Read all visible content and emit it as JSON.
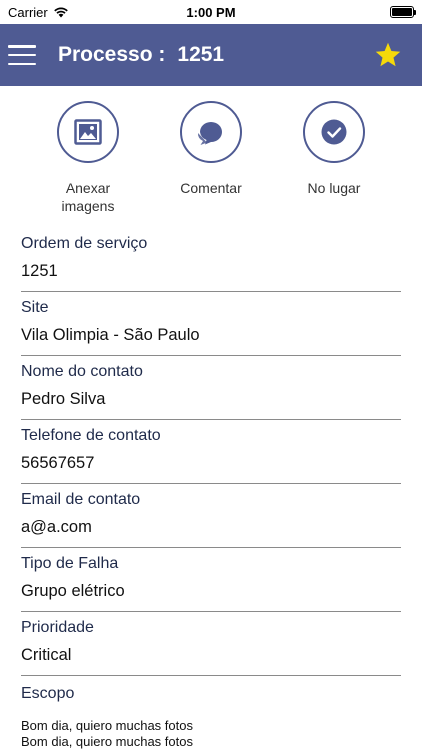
{
  "status_bar": {
    "carrier": "Carrier",
    "time": "1:00 PM"
  },
  "nav": {
    "title_prefix": "Processo :",
    "process_number": "1251"
  },
  "actions": [
    {
      "label": "Anexar imagens"
    },
    {
      "label": "Comentar"
    },
    {
      "label": "No lugar"
    }
  ],
  "fields": [
    {
      "label": "Ordem de serviço",
      "value": "1251"
    },
    {
      "label": "Site",
      "value": "Vila Olimpia - São Paulo"
    },
    {
      "label": "Nome do contato",
      "value": "Pedro Silva"
    },
    {
      "label": "Telefone de contato",
      "value": "56567657"
    },
    {
      "label": "Email de contato",
      "value": "a@a.com"
    },
    {
      "label": "Tipo de Falha",
      "value": "Grupo elétrico"
    },
    {
      "label": "Prioridade",
      "value": "Critical"
    }
  ],
  "escopo": {
    "label": "Escopo",
    "text": "Bom dia, quiero muchas fotos\nBom dia, quiero muchas fotos"
  },
  "colors": {
    "nav_bg": "#4f5b93",
    "accent": "#4f5b93",
    "star": "#f5d90a"
  },
  "icons": [
    "wifi-icon",
    "battery-icon",
    "menu-icon",
    "star-icon",
    "image-icon",
    "comment-icon",
    "check-icon"
  ]
}
